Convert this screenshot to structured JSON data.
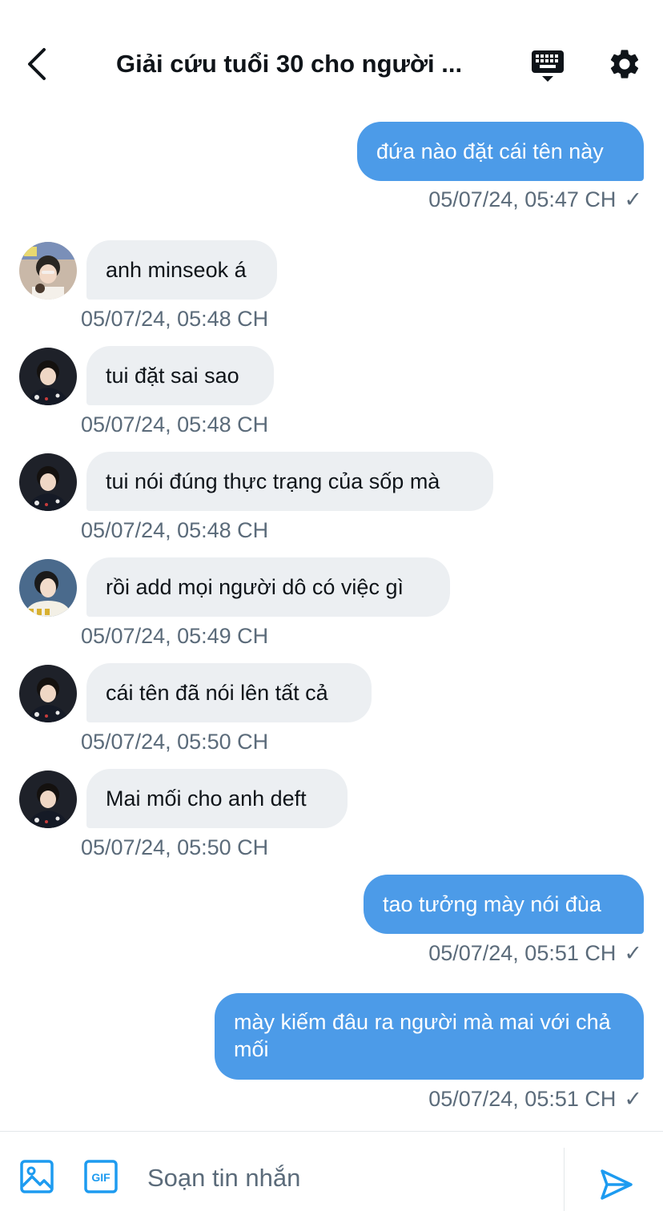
{
  "header": {
    "title": "Giải cứu tuổi 30 cho người ...",
    "back_icon": "chevron-left-icon",
    "keyboard_icon": "keyboard-icon",
    "settings_icon": "gear-icon"
  },
  "colors": {
    "outgoing_bubble": "#4c9be8",
    "incoming_bubble": "#eceff2",
    "accent": "#1d9bf0",
    "timestamp": "#5b6b7a"
  },
  "messages": [
    {
      "direction": "out",
      "text": "đứa nào đặt cái tên này",
      "timestamp": "05/07/24, 05:47 CH",
      "read_icon": "check-icon"
    },
    {
      "direction": "in",
      "text": "anh minseok á",
      "timestamp": "05/07/24, 05:48 CH"
    },
    {
      "direction": "in",
      "text": "tui đặt sai sao",
      "timestamp": "05/07/24, 05:48 CH"
    },
    {
      "direction": "in",
      "text": "tui nói đúng thực trạng của sốp mà",
      "timestamp": "05/07/24, 05:48 CH"
    },
    {
      "direction": "in",
      "text": "rồi add mọi người dô có việc gì",
      "timestamp": "05/07/24, 05:49 CH"
    },
    {
      "direction": "in",
      "text": "cái tên đã nói lên tất cả",
      "timestamp": "05/07/24, 05:50 CH"
    },
    {
      "direction": "in",
      "text": "Mai mối cho anh deft",
      "timestamp": "05/07/24, 05:50 CH"
    },
    {
      "direction": "out",
      "text": "tao tưởng mày nói đùa",
      "timestamp": "05/07/24, 05:51 CH",
      "read_icon": "check-icon"
    },
    {
      "direction": "out",
      "text": "mày kiếm đâu ra người mà mai với chả mối",
      "timestamp": "05/07/24, 05:51 CH",
      "read_icon": "check-icon"
    }
  ],
  "composer": {
    "placeholder": "Soạn tin nhắn",
    "image_icon": "image-icon",
    "gif_icon": "gif-icon",
    "gif_label": "GIF",
    "send_icon": "send-icon"
  }
}
